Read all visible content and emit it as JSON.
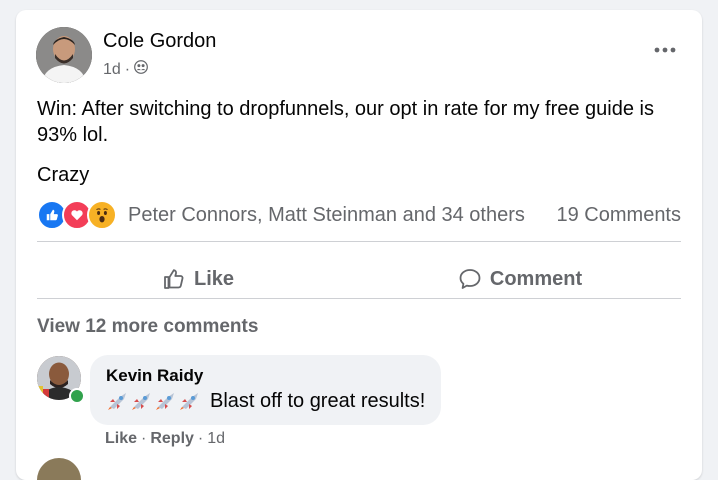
{
  "post": {
    "author": "Cole Gordon",
    "time": "1d",
    "separator": "·",
    "audience_icon": "friends-icon",
    "text_line1": "Win: After switching to dropfunnels, our opt in rate for my free guide is 93% lol.",
    "text_line2": "Crazy"
  },
  "reactions": {
    "icons": [
      "like-reaction-icon",
      "love-reaction-icon",
      "wow-reaction-icon"
    ],
    "summary": "Peter Connors, Matt Steinman and 34 others",
    "comments_count": "19 Comments"
  },
  "actions": {
    "like": "Like",
    "comment": "Comment"
  },
  "comments": {
    "view_more": "View 12 more comments",
    "items": [
      {
        "author": "Kevin Raidy",
        "emoji": "🚀🚀🚀🚀",
        "text": "Blast off to great results!",
        "like": "Like",
        "reply": "Reply",
        "time": "1d",
        "separator": "·"
      }
    ]
  },
  "colors": {
    "brand_blue": "#1877f2",
    "love_red": "#f33e58",
    "wow_yellow": "#f7b125",
    "secondary_text": "#65676b",
    "online_green": "#31a24c"
  }
}
